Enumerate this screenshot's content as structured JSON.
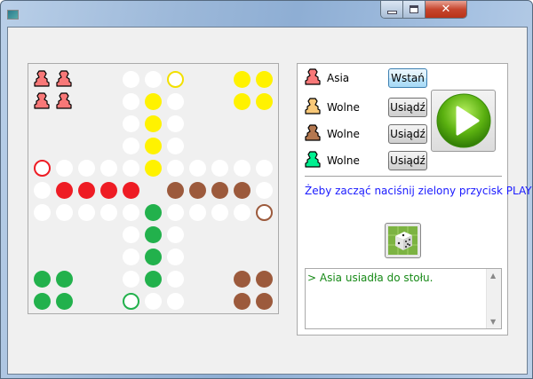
{
  "window": {
    "title": ""
  },
  "colors": {
    "red": "#ee1c24",
    "yellow": "#fff200",
    "green": "#22b14c",
    "brown": "#9c5a3c",
    "white": "#ffffff",
    "pawn_red": "#f87878",
    "pawn_yellow": "#f8c878",
    "pawn_brown": "#b47850",
    "pawn_green": "#00f090"
  },
  "board": {
    "legend": {
      "W": "white",
      "R": "red",
      "Y": "yellow",
      "G": "green",
      "B": "brown",
      "r": "red-start",
      "y": "yellow-start",
      "g": "green-start",
      "b": "brown-start",
      "P": "red-pawn",
      ".": "empty"
    },
    "rows": [
      "PP..WWy..YY",
      "PP..WYW..YY",
      "....WYW....",
      "....WYW....",
      "rWWWWYWWWWW",
      "WRRRR.BBBBW",
      "WWWWWGWWWWb",
      "....WGW....",
      "....WGW....",
      "GG..WGW..BB",
      "GG..gWW..BB"
    ]
  },
  "players": [
    {
      "name": "Asia",
      "color": "pawn_red",
      "button": "Wstań",
      "active": true
    },
    {
      "name": "Wolne",
      "color": "pawn_yellow",
      "button": "Usiądź",
      "active": false
    },
    {
      "name": "Wolne",
      "color": "pawn_brown",
      "button": "Usiądź",
      "active": false
    },
    {
      "name": "Wolne",
      "color": "pawn_green",
      "button": "Usiądź",
      "active": false
    }
  ],
  "hint": "Żeby zacząć naciśnij zielony przycisk PLAY",
  "log": [
    "> Asia usiadła do stołu."
  ],
  "icons": {
    "play": "play-icon",
    "dice": "dice-icon"
  }
}
